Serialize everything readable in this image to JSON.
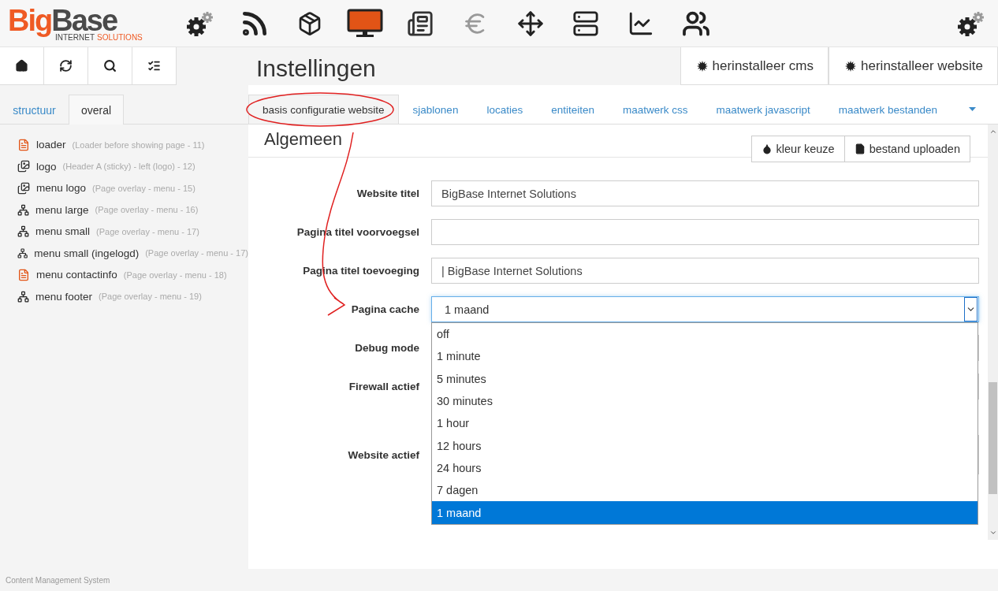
{
  "logo": {
    "brand_start": "Big",
    "brand_end": "Base",
    "tagline_start": "INTERNET",
    "tagline_end": "SOLUTIONS"
  },
  "page_title": "Instellingen",
  "header_buttons": [
    "herinstalleer cms",
    "herinstalleer website"
  ],
  "sidebar": {
    "tabs": [
      {
        "label": "structuur",
        "selected": false
      },
      {
        "label": "overal",
        "selected": true
      }
    ],
    "items": [
      {
        "kind": "document",
        "name": "loader",
        "detail": "(Loader before showing page - 11)"
      },
      {
        "kind": "gallery",
        "name": "logo",
        "detail": "(Header A (sticky) - left (logo) - 12)"
      },
      {
        "kind": "gallery",
        "name": "menu logo",
        "detail": "(Page overlay - menu - 15)"
      },
      {
        "kind": "tree",
        "name": "menu large",
        "detail": "(Page overlay - menu - 16)"
      },
      {
        "kind": "tree",
        "name": "menu small",
        "detail": "(Page overlay - menu - 17)"
      },
      {
        "kind": "tree",
        "name": "menu small (ingelogd)",
        "detail": "(Page overlay - menu - 17)"
      },
      {
        "kind": "document",
        "name": "menu contactinfo",
        "detail": "(Page overlay - menu - 18)"
      },
      {
        "kind": "tree",
        "name": "menu footer",
        "detail": "(Page overlay - menu - 19)"
      }
    ]
  },
  "tabs": [
    {
      "label": "basis configuratie website",
      "selected": true
    },
    {
      "label": "sjablonen",
      "selected": false
    },
    {
      "label": "locaties",
      "selected": false
    },
    {
      "label": "entiteiten",
      "selected": false
    },
    {
      "label": "maatwerk css",
      "selected": false
    },
    {
      "label": "maatwerk javascript",
      "selected": false
    },
    {
      "label": "maatwerk bestanden",
      "selected": false
    }
  ],
  "section": {
    "title": "Algemeen",
    "buttons": [
      {
        "kind": "color",
        "label": "kleur keuze"
      },
      {
        "kind": "upload",
        "label": "bestand uploaden"
      }
    ]
  },
  "fields": [
    {
      "kind": "text",
      "label": "Website titel",
      "value": "BigBase Internet Solutions"
    },
    {
      "kind": "text",
      "label": "Pagina titel voorvoegsel"
    },
    {
      "kind": "text",
      "label": "Pagina titel toevoeging",
      "value": "| BigBase Internet Solutions"
    },
    {
      "kind": "select",
      "label": "Pagina cache",
      "value": "1 maand",
      "expanded": true,
      "options": [
        {
          "label": "off",
          "selected": false
        },
        {
          "label": "1 minute",
          "selected": false
        },
        {
          "label": "5 minutes",
          "selected": false
        },
        {
          "label": "30 minutes",
          "selected": false
        },
        {
          "label": "1 hour",
          "selected": false
        },
        {
          "label": "12 hours",
          "selected": false
        },
        {
          "label": "24 hours",
          "selected": false
        },
        {
          "label": "7 dagen",
          "selected": false
        },
        {
          "label": "1 maand",
          "selected": true
        }
      ]
    },
    {
      "kind": "text",
      "label": "Debug mode"
    },
    {
      "kind": "text",
      "label": "Firewall actief"
    },
    {
      "kind": "tall",
      "label": "Website actief"
    }
  ],
  "footer": "Content Management System"
}
